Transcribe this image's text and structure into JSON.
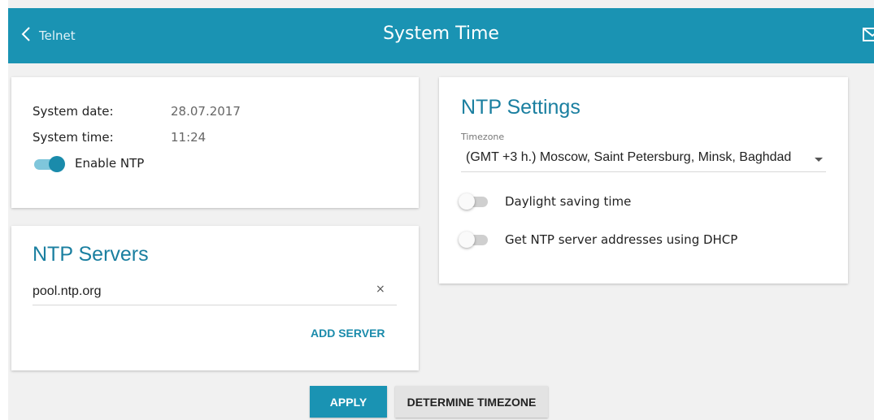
{
  "header": {
    "back_label": "Telnet",
    "title": "System Time",
    "back_icon": "chevron-left-icon",
    "mail_icon": "envelope-icon"
  },
  "system": {
    "date_label": "System date:",
    "date_value": "28.07.2017",
    "time_label": "System time:",
    "time_value": "11:24",
    "enable_ntp_label": "Enable NTP",
    "enable_ntp": true
  },
  "ntp_servers": {
    "title": "NTP Servers",
    "server_value": "pool.ntp.org",
    "clear_symbol": "×",
    "add_label": "ADD SERVER"
  },
  "ntp_settings": {
    "title": "NTP Settings",
    "timezone_label": "Timezone",
    "timezone_value": "(GMT +3 h.) Moscow, Saint Petersburg, Minsk, Baghdad",
    "dst_label": "Daylight saving time",
    "dst": false,
    "dhcp_label": "Get NTP server addresses using DHCP",
    "dhcp": false
  },
  "actions": {
    "apply_label": "APPLY",
    "determine_label": "DETERMINE TIMEZONE"
  },
  "colors": {
    "accent": "#1a93b3",
    "title_blue": "#1a7fa0"
  }
}
